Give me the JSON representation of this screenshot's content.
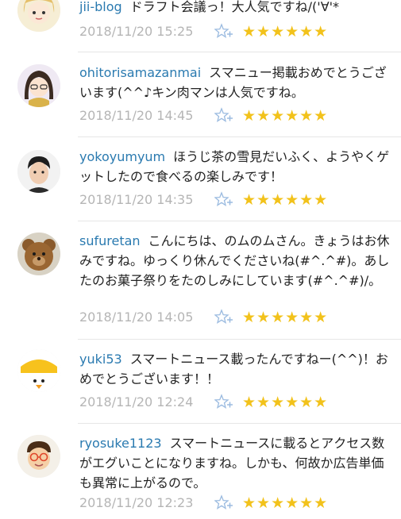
{
  "comments": [
    {
      "user": "jii-blog",
      "text": "ドラフト会議っ！大人気ですね/('∀'*",
      "time": "2018/11/20 15:25",
      "stars": "★★★★★★"
    },
    {
      "user": "ohitorisamazanmai",
      "text": "スマニュー掲載おめでとうございます(^^♪キン肉マンは人気ですね。",
      "time": "2018/11/20 14:45",
      "stars": "★★★★★★"
    },
    {
      "user": "yokoyumyum",
      "text": "ほうじ茶の雪見だいふく、ようやくゲットしたので食べるの楽しみです！",
      "time": "2018/11/20 14:35",
      "stars": "★★★★★★"
    },
    {
      "user": "sufuretan",
      "text": "こんにちは、のムのムさん。きょうはお休みですね。ゆっくり休んでくださいね(#^.^#)。あしたのお菓子祭りをたのしみにしています(#^.^#)/。",
      "time": "2018/11/20 14:05",
      "stars": "★★★★★★"
    },
    {
      "user": "yuki53",
      "text": "スマートニュース載ったんですねー(^^)！おめでとうございます！！",
      "time": "2018/11/20 12:24",
      "stars": "★★★★★★"
    },
    {
      "user": "ryosuke1123",
      "text": "スマートニュースに載るとアクセス数がエグいことになりますね。しかも、何故か広告単価も異常に上がるので。",
      "time": "2018/11/20 12:23",
      "stars": "★★★★★★"
    }
  ]
}
